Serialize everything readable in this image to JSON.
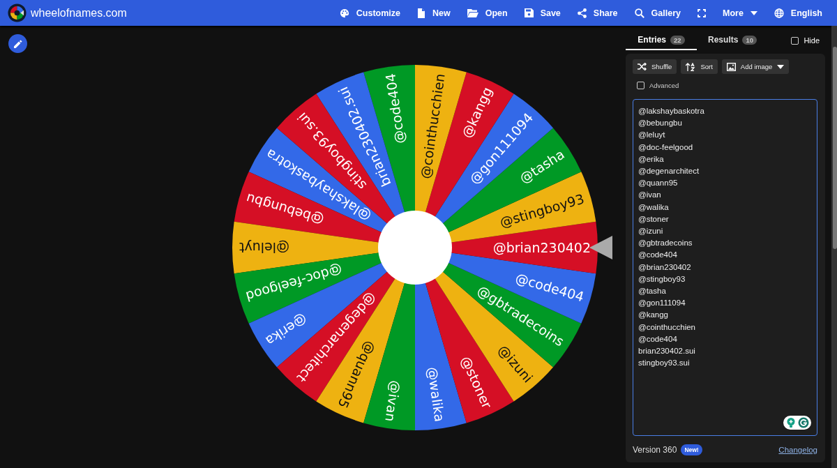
{
  "app": {
    "site_name": "wheelofnames.com"
  },
  "nav": [
    {
      "label": "Customize",
      "kind": "button"
    },
    {
      "label": "New",
      "kind": "button"
    },
    {
      "label": "Open",
      "kind": "button"
    },
    {
      "label": "Save",
      "kind": "button"
    },
    {
      "label": "Share",
      "kind": "button"
    },
    {
      "label": "Gallery",
      "kind": "button"
    },
    {
      "kind": "icon-button"
    },
    {
      "label": "More",
      "kind": "menu"
    },
    {
      "label": "English",
      "kind": "button"
    }
  ],
  "wheel": {
    "segments": [
      {
        "label": "@lakshaybaskotra",
        "color": "#3369e8"
      },
      {
        "label": "@bebungbu",
        "color": "#d50f25"
      },
      {
        "label": "@leluyt",
        "color": "#eeb211"
      },
      {
        "label": "@doc-feelgood",
        "color": "#009925"
      },
      {
        "label": "@erika",
        "color": "#3369e8"
      },
      {
        "label": "@degenarchitect",
        "color": "#d50f25"
      },
      {
        "label": "@quann95",
        "color": "#eeb211"
      },
      {
        "label": "@ivan",
        "color": "#009925"
      },
      {
        "label": "@walika",
        "color": "#3369e8"
      },
      {
        "label": "@stoner",
        "color": "#d50f25"
      },
      {
        "label": "@izuni",
        "color": "#eeb211"
      },
      {
        "label": "@gbtradecoins",
        "color": "#009925"
      },
      {
        "label": "@code404",
        "color": "#3369e8"
      },
      {
        "label": "@brian230402",
        "color": "#d50f25"
      },
      {
        "label": "@stingboy93",
        "color": "#eeb211"
      },
      {
        "label": "@tasha",
        "color": "#009925"
      },
      {
        "label": "@gon111094",
        "color": "#3369e8"
      },
      {
        "label": "@kangg",
        "color": "#d50f25"
      },
      {
        "label": "@cointhucchien",
        "color": "#eeb211"
      },
      {
        "label": "@code404",
        "color": "#009925"
      },
      {
        "label": "brian230402.sui",
        "color": "#3369e8"
      },
      {
        "label": "stingboy93.sui",
        "color": "#d50f25"
      }
    ]
  },
  "tabs": [
    {
      "label": "Entries",
      "count": "22",
      "selected": true
    },
    {
      "label": "Results",
      "count": "10",
      "selected": false
    }
  ],
  "hide": {
    "label": "Hide",
    "checked": false
  },
  "toolbar": [
    {
      "label": "Shuffle",
      "kind": "button"
    },
    {
      "label": "Sort",
      "kind": "button"
    },
    {
      "label": "Add image",
      "kind": "menu"
    }
  ],
  "advanced": {
    "label": "Advanced",
    "checked": false
  },
  "entries": [
    "@lakshaybaskotra",
    "@bebungbu",
    "@leluyt",
    "@doc-feelgood",
    "@erika",
    "@degenarchitect",
    "@quann95",
    "@ivan",
    "@walika",
    "@stoner",
    "@izuni",
    "@gbtradecoins",
    "@code404",
    "@brian230402",
    "@stingboy93",
    "@tasha",
    "@gon111094",
    "@kangg",
    "@cointhucchien",
    "@code404",
    "brian230402.sui",
    "stingboy93.sui"
  ],
  "footer": {
    "version": "Version 360",
    "badge": "New!",
    "link": "Changelog"
  }
}
